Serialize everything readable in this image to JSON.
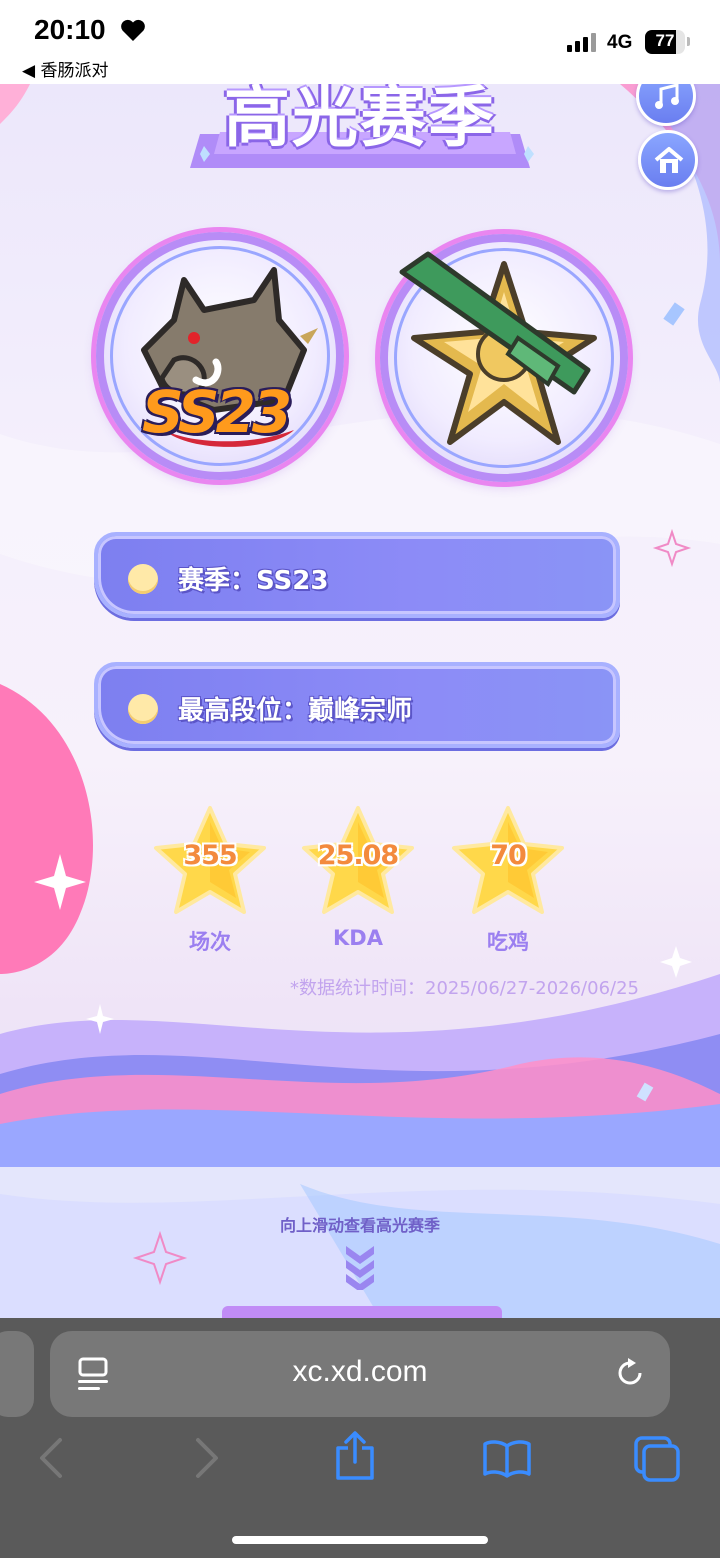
{
  "status_bar": {
    "time": "20:10",
    "back_label": "◀ 香肠派对",
    "network": "4G",
    "battery": "77",
    "battery_level": 0.77
  },
  "page": {
    "title": "高光赛季",
    "season_label": "赛季：SS23",
    "rank_label": "最高段位：巅峰宗师",
    "medal_season_text": "SS23",
    "stats": [
      {
        "value": "355",
        "caption": "场次"
      },
      {
        "value": "25.08",
        "caption": "KDA"
      },
      {
        "value": "70",
        "caption": "吃鸡"
      }
    ],
    "note": "*数据统计时间：2025/06/27-2026/06/25",
    "scroll_hint": "向上滑动查看高光赛季"
  },
  "browser": {
    "url": "xc.xd.com"
  },
  "colors": {
    "bar": "#8c8bf7",
    "stat_value": "#f38a3d",
    "stat_caption": "#9b7ff0",
    "browser_bg": "#5a5a5a",
    "accent_blue": "#3a8cff"
  },
  "icons": [
    "heart-icon",
    "music-icon",
    "home-icon",
    "reader-icon",
    "reload-icon",
    "back-arrow-icon",
    "forward-arrow-icon",
    "share-icon",
    "bookmarks-icon",
    "tabs-icon",
    "chevrons-down-icon"
  ]
}
